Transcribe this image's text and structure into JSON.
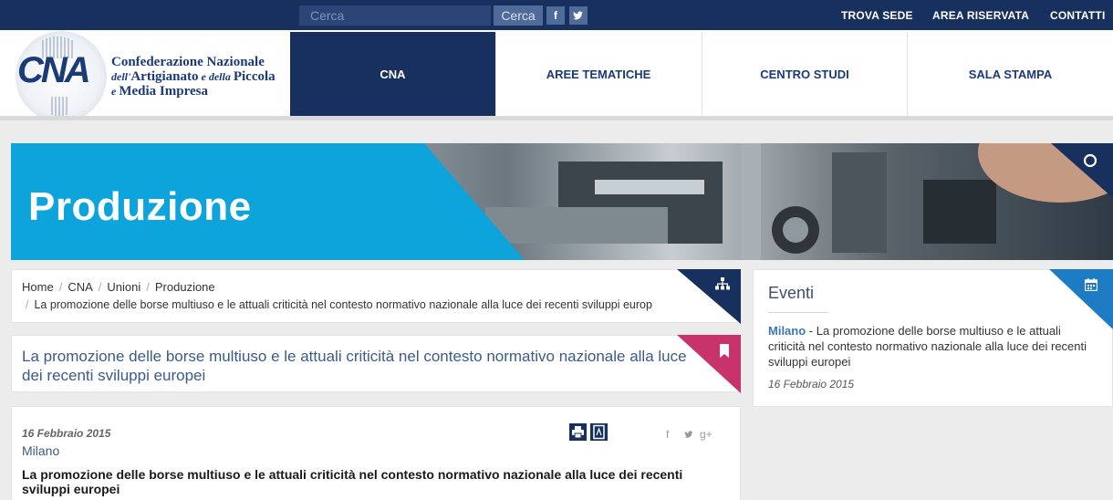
{
  "topbar": {
    "search_placeholder": "Cerca",
    "search_button": "Cerca",
    "facebook_glyph": "f",
    "twitter_glyph": "t",
    "links": [
      "TROVA SEDE",
      "AREA RISERVATA",
      "CONTATTI"
    ]
  },
  "header": {
    "logo_text": "CNA",
    "org_name_line1": "Confederazione Nazionale",
    "org_name_line2_prefix": "dell'",
    "org_name_line2_a": "Artigianato",
    "org_name_line2_mid": " e della ",
    "org_name_line2_b": "Piccola",
    "org_name_line3_prefix": "e ",
    "org_name_line3": "Media Impresa",
    "nav": [
      "CNA",
      "AREE TEMATICHE",
      "CENTRO STUDI",
      "SALA STAMPA"
    ],
    "active_nav": "CNA"
  },
  "banner": {
    "title": "Produzione"
  },
  "breadcrumb": {
    "items": [
      "Home",
      "CNA",
      "Unioni",
      "Produzione"
    ],
    "current": "La promozione delle borse multiuso e le attuali criticità nel contesto normativo nazionale alla luce dei recenti sviluppi europ"
  },
  "article": {
    "title": "La promozione delle borse multiuso e le attuali criticità nel contesto normativo nazionale alla luce dei recenti sviluppi europei",
    "date": "16 Febbraio 2015",
    "city": "Milano",
    "body_title": "La promozione delle borse multiuso e le attuali criticità nel contesto normativo nazionale alla luce dei recenti sviluppi europei",
    "share": [
      "f",
      "t",
      "g+"
    ]
  },
  "events": {
    "title": "Eventi",
    "item_city": "Milano",
    "item_text": " - La promozione delle borse multiuso e le attuali criticità nel contesto normativo nazionale alla luce dei recenti sviluppi europei",
    "item_date": "16 Febbraio 2015"
  },
  "colors": {
    "navy": "#17305e",
    "banner_blue": "#0da4dc",
    "bookmark_pink": "#c8336b",
    "event_blue": "#1d7cc4",
    "link_blue": "#3c5a8a"
  },
  "icons": [
    "facebook-icon",
    "twitter-icon",
    "sitemap-icon",
    "bookmark-icon",
    "calendar-icon",
    "print-icon",
    "pdf-icon",
    "googleplus-icon",
    "refresh-icon"
  ]
}
